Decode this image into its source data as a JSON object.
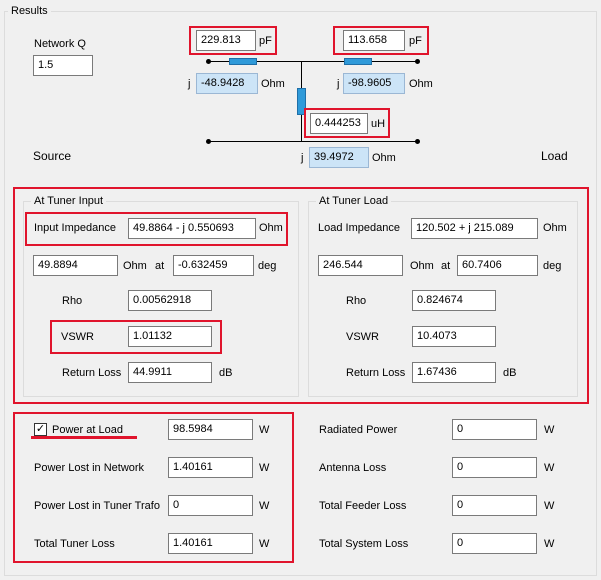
{
  "results": {
    "title": "Results",
    "network_q": {
      "label": "Network Q",
      "value": "1.5"
    },
    "c1": {
      "value": "229.813",
      "unit": "pF"
    },
    "c2": {
      "value": "113.658",
      "unit": "pF"
    },
    "x1": {
      "j": "j",
      "value": "-48.9428",
      "unit": "Ohm"
    },
    "x2": {
      "j": "j",
      "value": "-98.9605",
      "unit": "Ohm"
    },
    "l1": {
      "value": "0.444253",
      "unit": "uH"
    },
    "xl": {
      "j": "j",
      "value": "39.4972",
      "unit": "Ohm"
    },
    "source_label": "Source",
    "load_label": "Load"
  },
  "tuner_input": {
    "title": "At Tuner Input",
    "impedance_label": "Input Impedance",
    "impedance_value": "49.8864 - j 0.550693",
    "impedance_unit": "Ohm",
    "mag_value": "49.8894",
    "mag_unit": "Ohm",
    "at_label": "at",
    "angle_value": "-0.632459",
    "angle_unit": "deg",
    "rho_label": "Rho",
    "rho_value": "0.00562918",
    "vswr_label": "VSWR",
    "vswr_value": "1.01132",
    "rl_label": "Return Loss",
    "rl_value": "44.9911",
    "rl_unit": "dB"
  },
  "tuner_load": {
    "title": "At Tuner Load",
    "impedance_label": "Load Impedance",
    "impedance_value": "120.502 + j 215.089",
    "impedance_unit": "Ohm",
    "mag_value": "246.544",
    "mag_unit": "Ohm",
    "at_label": "at",
    "angle_value": "60.7406",
    "angle_unit": "deg",
    "rho_label": "Rho",
    "rho_value": "0.824674",
    "vswr_label": "VSWR",
    "vswr_value": "10.4073",
    "rl_label": "Return Loss",
    "rl_value": "1.67436",
    "rl_unit": "dB"
  },
  "power": {
    "checkbox_checked": true,
    "check_mark": "✓",
    "power_at_load_label": "Power at Load",
    "power_at_load_value": "98.5984",
    "lost_network_label": "Power Lost in Network",
    "lost_network_value": "1.40161",
    "lost_trafo_label": "Power Lost in Tuner Trafo",
    "lost_trafo_value": "0",
    "total_tuner_label": "Total Tuner Loss",
    "total_tuner_value": "1.40161",
    "unit": "W"
  },
  "system": {
    "radiated_label": "Radiated Power",
    "radiated_value": "0",
    "antenna_loss_label": "Antenna Loss",
    "antenna_loss_value": "0",
    "feeder_loss_label": "Total Feeder Loss",
    "feeder_loss_value": "0",
    "system_loss_label": "Total System Loss",
    "system_loss_value": "0",
    "unit": "W"
  },
  "colors": {
    "highlight": "#e0142c",
    "component": "#2f9ad9",
    "readonly_field": "#cce4f7"
  }
}
